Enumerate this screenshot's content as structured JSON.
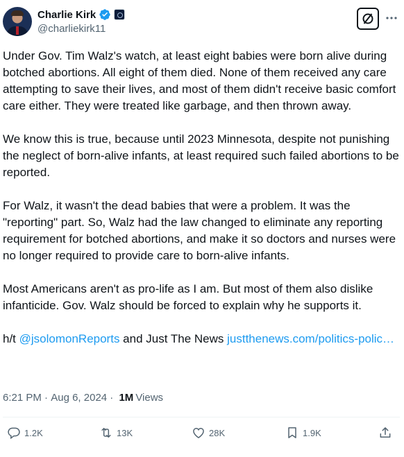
{
  "author": {
    "display_name": "Charlie Kirk",
    "handle": "@charliekirk11",
    "verified": true,
    "avatar_icon": "profile-photo"
  },
  "tweet": {
    "paragraphs": [
      "Under Gov. Tim Walz's watch, at least eight babies were born alive during botched abortions. All eight of them died. None of them received any care attempting to save their lives, and most of them didn't receive basic comfort care either. They were treated like garbage, and then thrown away.",
      "We know this is true, because until 2023 Minnesota, despite not punishing the neglect of born-alive infants, at least required such failed abortions to be reported.",
      "For Walz, it wasn't the dead babies that were a problem. It was the \"reporting\" part. So, Walz had the law changed to eliminate any reporting requirement for botched abortions, and make it so doctors and nurses were no longer required to provide care to born-alive infants.",
      "Most Americans aren't as pro-life as I am. But most of them also dislike infanticide. Gov. Walz should be forced to explain why he supports it."
    ],
    "credit": {
      "prefix": "h/t ",
      "mention": "@jsolomonReports",
      "middle": " and Just The News ",
      "link": "justthenews.com/politics-polic…"
    },
    "time": "6:21 PM",
    "date": "Aug 6, 2024",
    "separator": " · ",
    "views_count": "1M",
    "views_label": "Views"
  },
  "actions": {
    "replies": "1.2K",
    "reposts": "13K",
    "likes": "28K",
    "bookmarks": "1.9K"
  },
  "colors": {
    "link": "#1d9bf0",
    "text": "#0f1419",
    "secondary": "#536471",
    "verified_badge": "#1d9bf0"
  }
}
